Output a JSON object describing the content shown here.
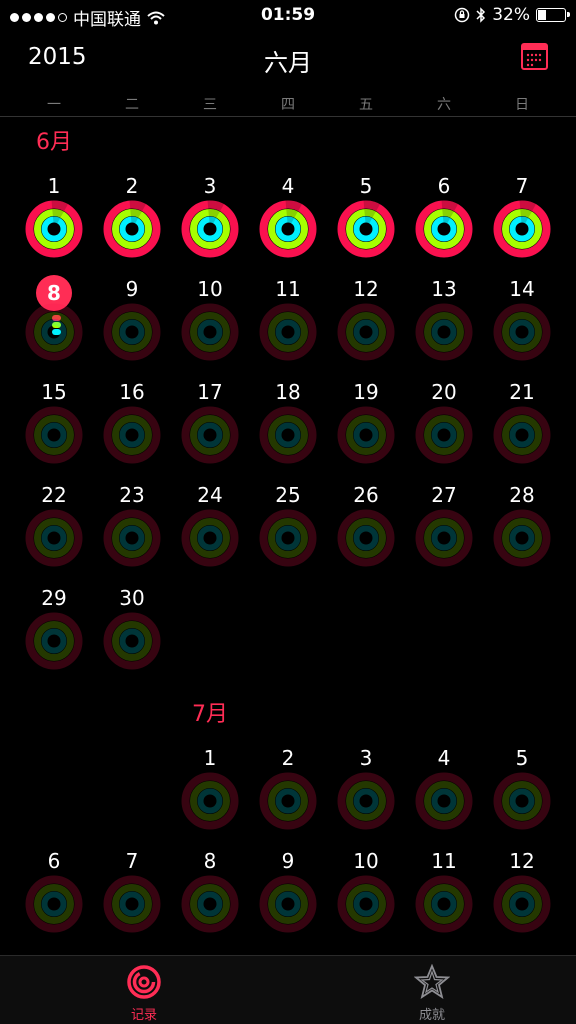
{
  "status": {
    "carrier": "中国联通",
    "time": "01:59",
    "battery": "32%"
  },
  "nav": {
    "year": "2015",
    "title": "六月"
  },
  "weekdays": [
    "一",
    "二",
    "三",
    "四",
    "五",
    "六",
    "日"
  ],
  "june": {
    "label": "6月",
    "today": "8",
    "weeks": [
      [
        "1",
        "2",
        "3",
        "4",
        "5",
        "6",
        "7"
      ],
      [
        "8",
        "9",
        "10",
        "11",
        "12",
        "13",
        "14"
      ],
      [
        "15",
        "16",
        "17",
        "18",
        "19",
        "20",
        "21"
      ],
      [
        "22",
        "23",
        "24",
        "25",
        "26",
        "27",
        "28"
      ],
      [
        "29",
        "30"
      ]
    ]
  },
  "july": {
    "label": "7月",
    "weeks": [
      [
        "1",
        "2",
        "3",
        "4",
        "5"
      ],
      [
        "6",
        "7",
        "8",
        "9",
        "10",
        "11",
        "12"
      ]
    ]
  },
  "tabs": [
    {
      "label": "记录",
      "active": true
    },
    {
      "label": "成就",
      "active": false
    }
  ],
  "colors": {
    "accent": "#ff2d55",
    "move": "#fa114f",
    "exercise": "#a6ff00",
    "stand": "#00f0ff"
  }
}
